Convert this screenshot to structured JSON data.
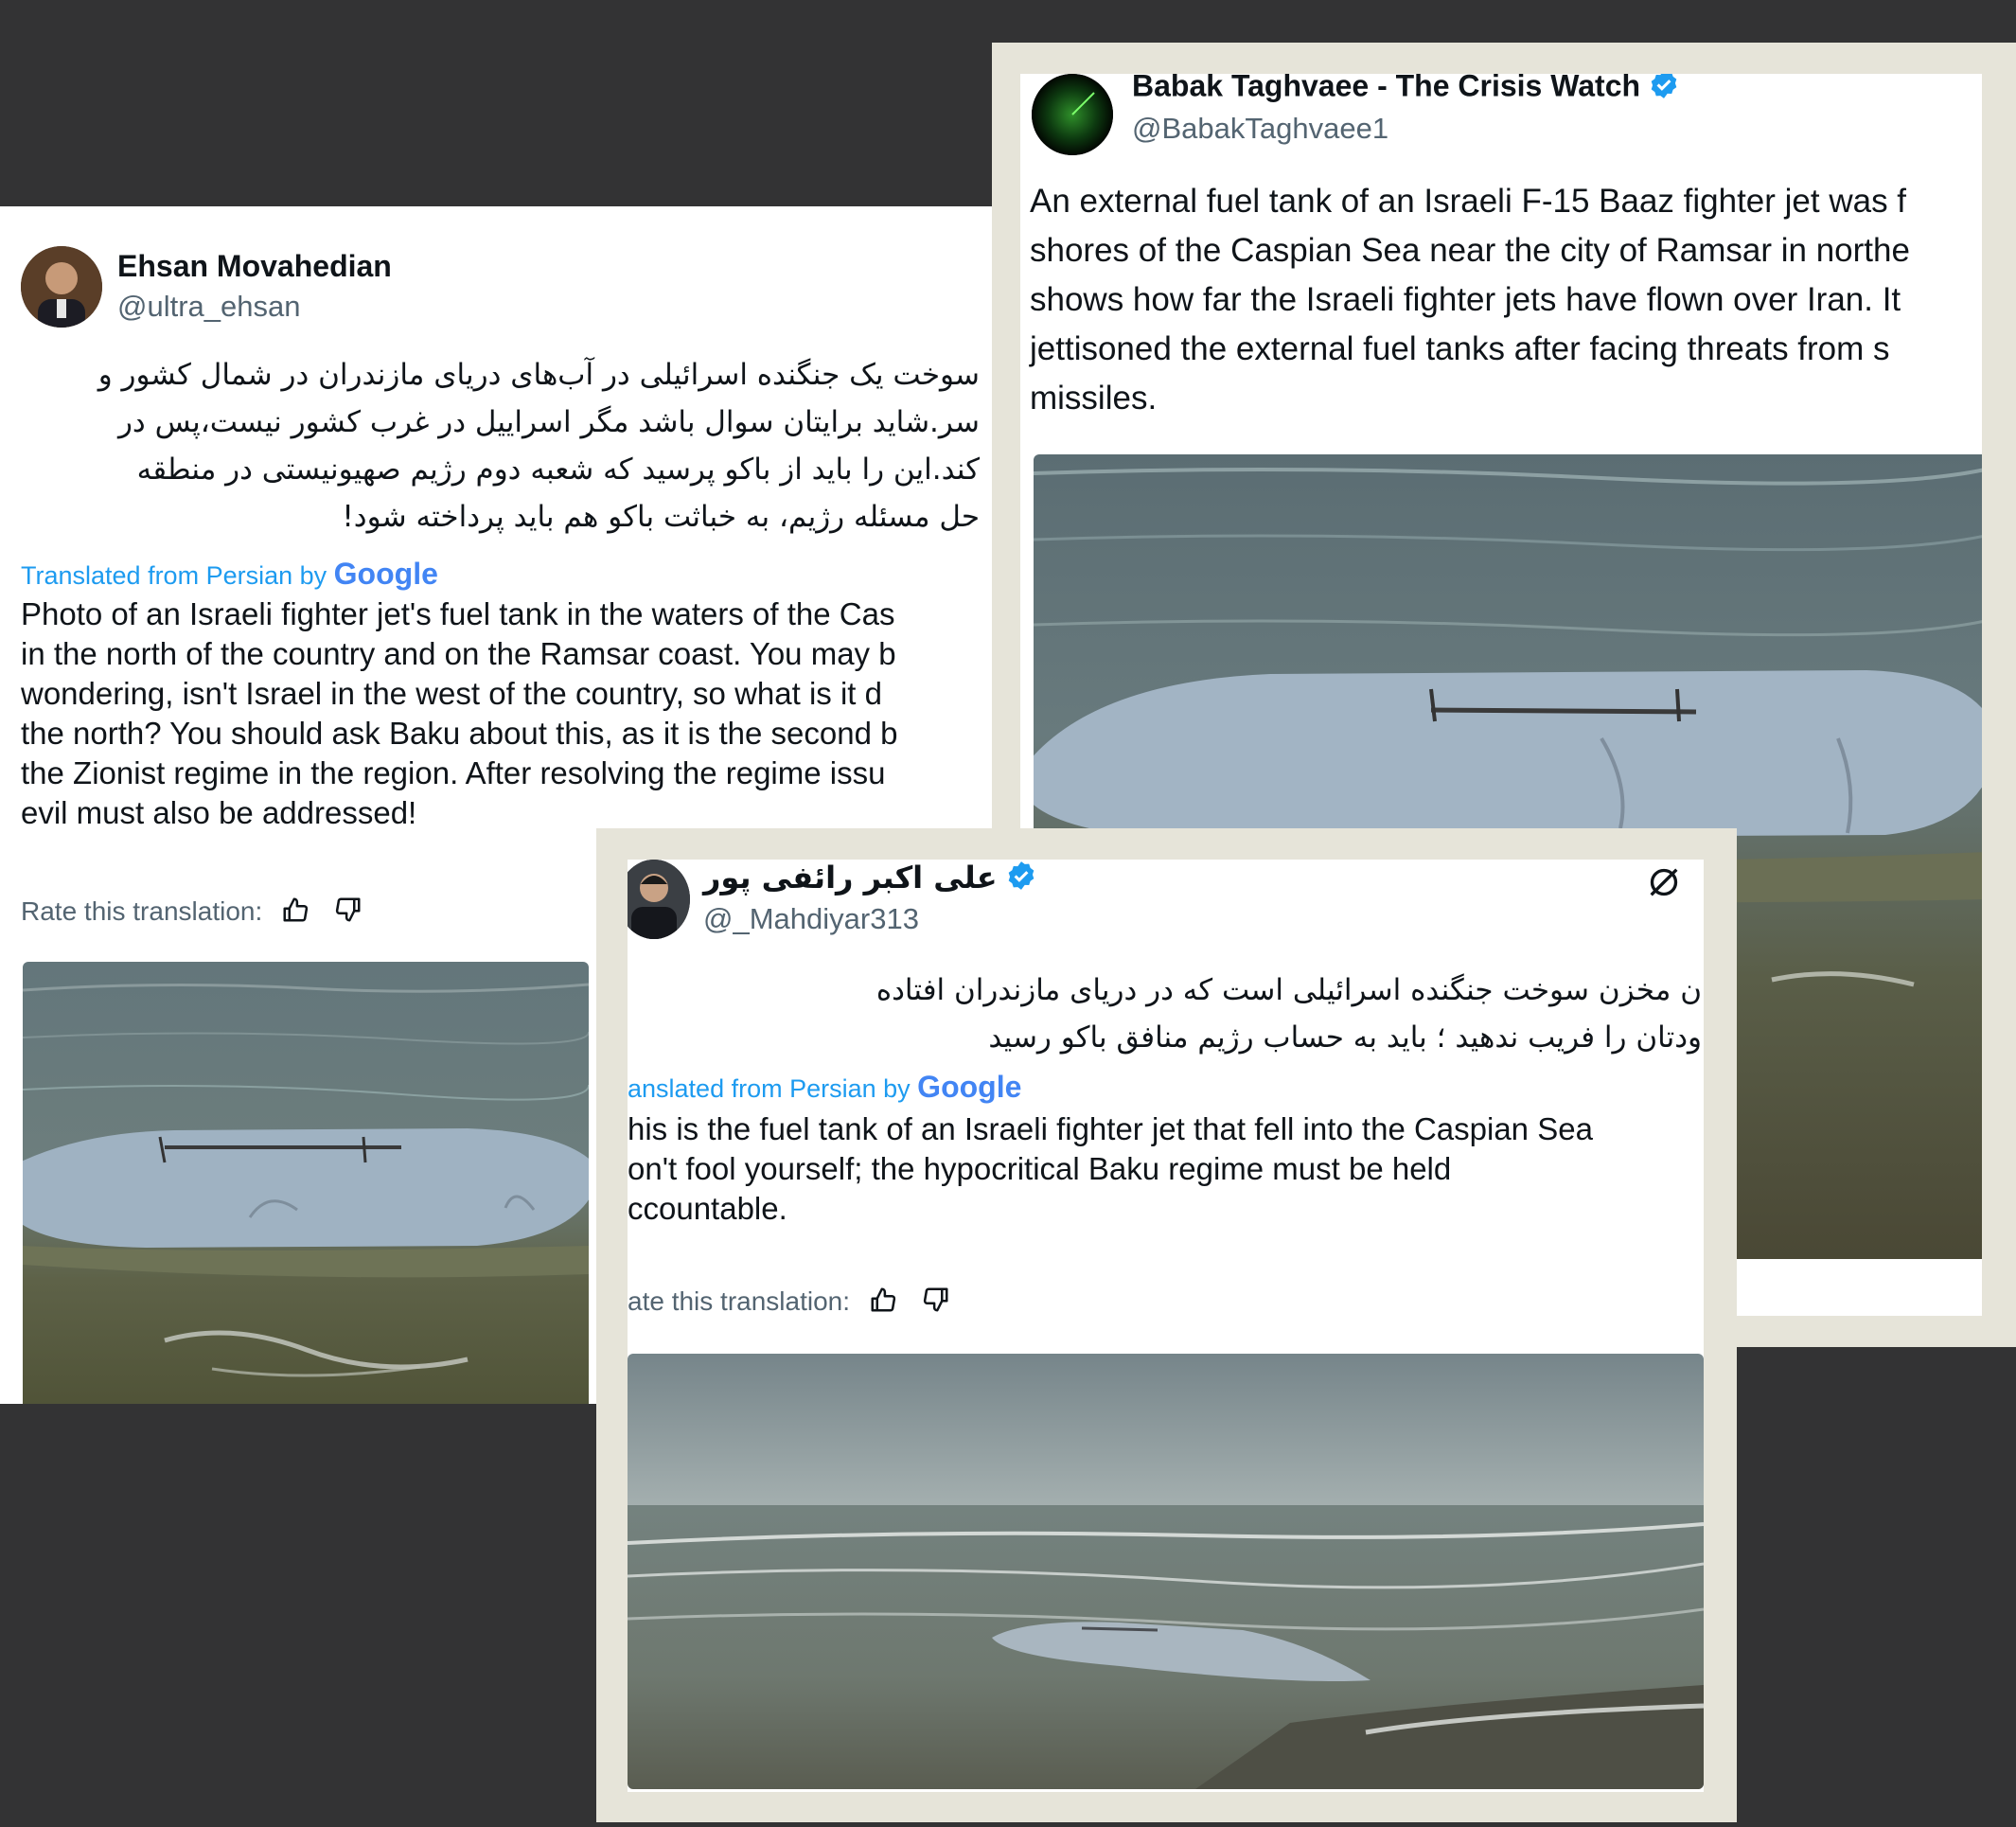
{
  "tweets": [
    {
      "name": "Ehsan Movahedian",
      "handle": "@ultra_ehsan",
      "original_lines": [
        "سوخت یک جنگنده اسرائیلی در آب‌های دریای مازندران در شمال کشور و",
        "سر.شاید برایتان سوال باشد مگر اسراییل در غرب کشور نیست،پس در",
        "کند.این را باید از باکو پرسید که شعبه دوم رژیم صهیونیستی در منطقه",
        "حل مسئله رژیم، به خباثت باکو هم باید پرداخته شود!"
      ],
      "translated_prefix": "Translated from Persian by",
      "google": "Google",
      "translation_lines": [
        "Photo of an Israeli fighter jet's fuel tank in the waters of the Cas",
        "in the north of the country and on the Ramsar coast. You may b",
        "wondering, isn't Israel in the west of the country, so what is it d",
        "the north? You should ask Baku about this, as it is the second b",
        "the Zionist regime in the region. After resolving the regime issu",
        "evil must also be addressed!"
      ],
      "rate_label": "Rate this translation:"
    },
    {
      "name": "Babak Taghvaee - The Crisis Watch",
      "handle": "@BabakTaghvaee1",
      "text_lines": [
        "An external fuel tank of an Israeli F-15 Baaz fighter jet was f",
        "shores of the Caspian Sea near the city of Ramsar in northe",
        "shows how far the Israeli fighter jets have flown over Iran. It",
        "jettisoned the external fuel tanks after facing threats from s",
        "missiles."
      ]
    },
    {
      "name": "علی اکبر رائفی پور",
      "handle": "@_Mahdiyar313",
      "original_lines": [
        "ن مخزن سوخت جنگنده اسرائیلی است که در دریای مازندران افتاده",
        "ودتان را فریب ندهید ؛ باید به حساب رژیم منافق باکو رسید"
      ],
      "translated_prefix": "anslated from Persian by",
      "google": "Google",
      "translation_lines": [
        "his is the fuel tank of an Israeli fighter jet that fell into the Caspian Sea",
        "on't fool yourself; the hypocritical Baku regime must be held",
        "ccountable."
      ],
      "rate_label": "ate this translation:"
    }
  ],
  "icons": [
    "thumbs-up-icon",
    "thumbs-down-icon",
    "verified-badge-icon",
    "grok-icon"
  ],
  "colors": {
    "background": "#333334",
    "frame": "#e6e4d9",
    "link_blue": "#1d9bf0",
    "verified": "#1d9bf0"
  }
}
